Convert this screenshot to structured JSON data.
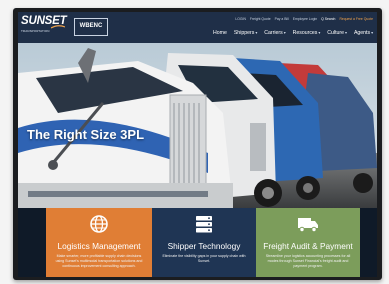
{
  "header": {
    "logo_text": "SUNSET",
    "logo_tagline": "TRANSPORTATION",
    "badge": "WBENC",
    "utility_links": [
      "LOGIN",
      "Freight Quote",
      "Pay a Bill",
      "Employee Login",
      "Q Search",
      "Request a Free Quote"
    ],
    "nav": [
      "Home",
      "Shippers",
      "Carriers",
      "Resources",
      "Culture",
      "Agents"
    ]
  },
  "hero": {
    "headline": "The Right Size 3PL"
  },
  "cards": [
    {
      "title": "Logistics Management",
      "description": "Make smarter, more profitable supply chain decisions using Sunset's multimodal transportation solutions and continuous improvement consulting approach.",
      "icon": "globe-icon",
      "color": "#e07e35"
    },
    {
      "title": "Shipper Technology",
      "description": "Eliminate the visibility gaps in your supply chain with Sunset.",
      "icon": "server-icon",
      "color": "#1f3554"
    },
    {
      "title": "Freight Audit & Payment",
      "description": "Streamline your logistics accounting processes for all modes through Sunset Financial's freight audit and payment program.",
      "icon": "truck-icon",
      "color": "#7c9d5b"
    }
  ],
  "colors": {
    "header_bg": "#1f2f48",
    "accent_orange": "#e07e35",
    "accent_navy": "#1f3554",
    "accent_green": "#7c9d5b"
  }
}
